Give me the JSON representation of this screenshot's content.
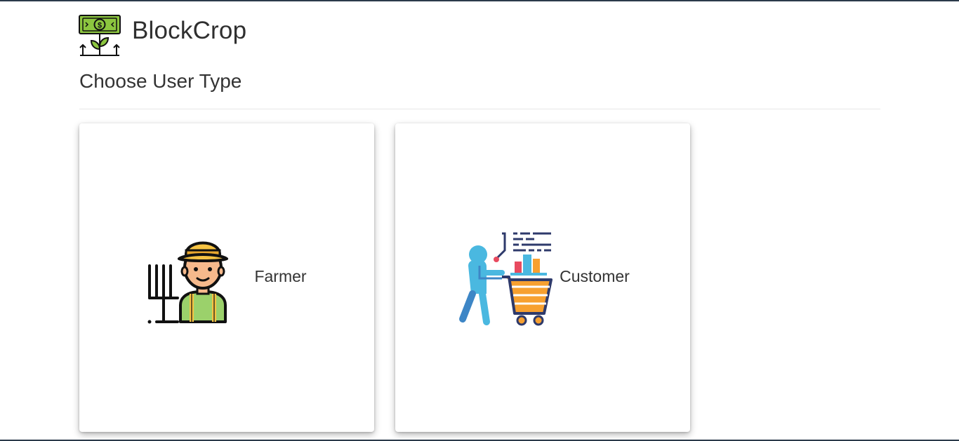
{
  "brand": {
    "name": "BlockCrop",
    "logo_icon": "money-plant-icon"
  },
  "page": {
    "title": "Choose User Type"
  },
  "cards": [
    {
      "label": "Farmer",
      "icon": "farmer-icon"
    },
    {
      "label": "Customer",
      "icon": "customer-shopping-cart-icon"
    }
  ],
  "colors": {
    "money_green": "#8cc63f",
    "farmer_hat": "#f6c343",
    "farmer_skin": "#f6b98c",
    "farmer_shirt": "#9bd16b",
    "customer_blue": "#4ab8e0",
    "cart_orange": "#f7a030",
    "cart_navy": "#2e3a6b"
  }
}
